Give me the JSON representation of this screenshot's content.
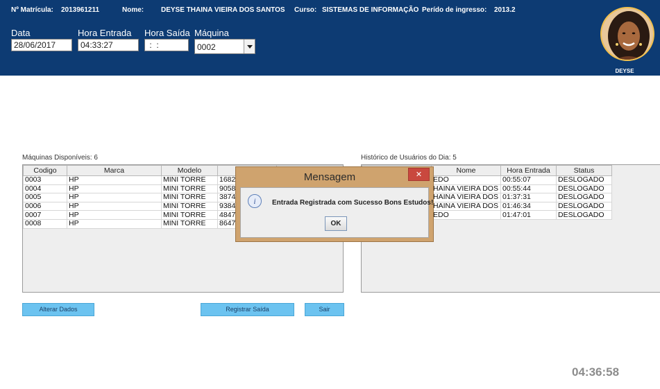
{
  "header": {
    "matricula_label": "Nº Matrícula:",
    "matricula_value": "2013961211",
    "nome_label": "Nome:",
    "nome_value": "DEYSE THAINA VIEIRA DOS SANTOS",
    "curso_label": "Curso:",
    "curso_value": "SISTEMAS DE INFORMAÇÃO",
    "periodo_label": "Perído de ingresso:",
    "periodo_value": "2013.2",
    "avatar_name": "DEYSE"
  },
  "form": {
    "data_label": "Data",
    "data_value": "28/06/2017",
    "hora_entrada_label": "Hora Entrada",
    "hora_entrada_value": "04:33:27",
    "hora_saida_label": "Hora Saída",
    "hora_saida_value": " :  : ",
    "maquina_label": "Máquina",
    "maquina_value": "0002"
  },
  "machines": {
    "title": "Máquinas Disponíveis: 6",
    "columns": [
      "Codigo",
      "Marca",
      "Modelo",
      "N",
      ""
    ],
    "rows": [
      [
        "0003",
        "HP",
        "MINI TORRE",
        "1682"
      ],
      [
        "0004",
        "HP",
        "MINI TORRE",
        "9058"
      ],
      [
        "0005",
        "HP",
        "MINI TORRE",
        "3874"
      ],
      [
        "0006",
        "HP",
        "MINI TORRE",
        "9384"
      ],
      [
        "0007",
        "HP",
        "MINI TORRE",
        "4847"
      ],
      [
        "0008",
        "HP",
        "MINI TORRE",
        "8647"
      ]
    ]
  },
  "history": {
    "title": "Histórico de Usuários do Dia: 5",
    "columns": [
      "",
      "Nome",
      "Hora Entrada",
      "Status"
    ],
    "rows": [
      [
        "",
        "EDO",
        "00:55:07",
        "DESLOGADO"
      ],
      [
        "",
        "HAINA VIEIRA DOS ...",
        "00:55:44",
        "DESLOGADO"
      ],
      [
        "",
        "HAINA VIEIRA DOS ...",
        "01:37:31",
        "DESLOGADO"
      ],
      [
        "",
        "HAINA VIEIRA DOS ...",
        "01:46:34",
        "DESLOGADO"
      ],
      [
        "",
        "EDO",
        "01:47:01",
        "DESLOGADO"
      ]
    ]
  },
  "buttons": {
    "alterar": "Alterar Dados",
    "registrar": "Registrar Saída",
    "sair": "Sair"
  },
  "clock": "04:36:58",
  "dialog": {
    "title": "Mensagem",
    "close": "✕",
    "icon": "i",
    "message": "Entrada Registrada com Sucesso Bons Estudos!",
    "ok": "OK"
  },
  "colors": {
    "header_bg": "#0d3b73",
    "button_bg": "#6cc3f0",
    "dialog_frame": "#cfa36e",
    "close_button": "#c9483e"
  }
}
